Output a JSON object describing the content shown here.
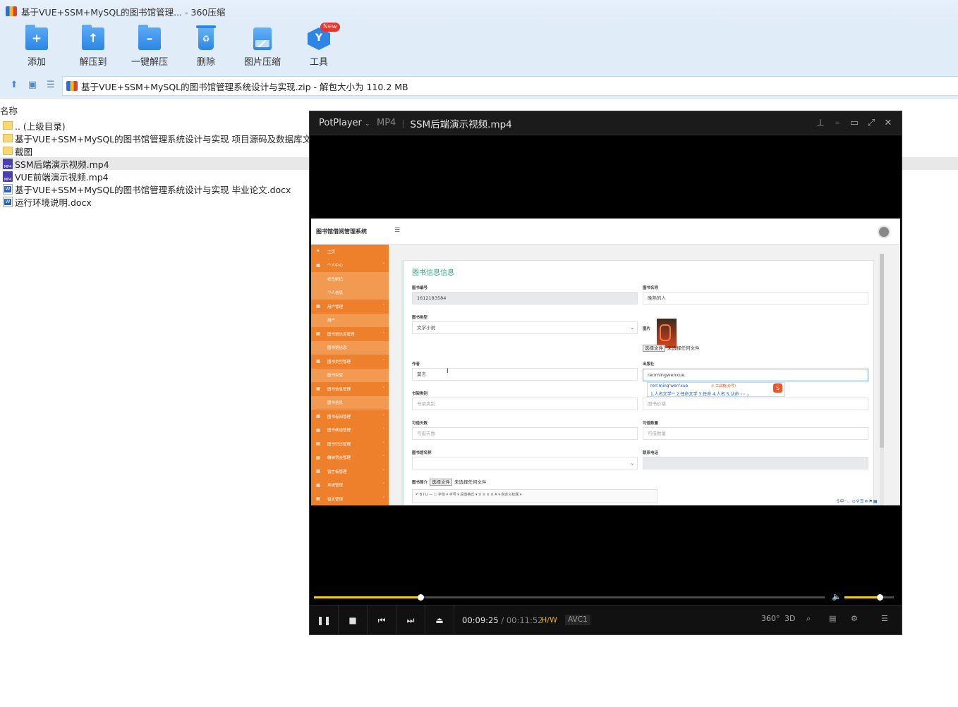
{
  "window": {
    "title": "基于VUE+SSM+MySQL的图书馆管理... - 360压缩"
  },
  "toolbar": {
    "items": [
      {
        "label": "添加",
        "icon": "add-folder-icon"
      },
      {
        "label": "解压到",
        "icon": "extract-to-icon"
      },
      {
        "label": "一键解压",
        "icon": "one-click-extract-icon"
      },
      {
        "label": "删除",
        "icon": "delete-bin-icon"
      },
      {
        "label": "图片压缩",
        "icon": "image-compress-icon"
      },
      {
        "label": "工具",
        "icon": "tools-icon"
      }
    ],
    "new_badge": "New"
  },
  "address": {
    "path": "基于VUE+SSM+MySQL的图书馆管理系统设计与实现.zip - 解包大小为 110.2 MB"
  },
  "filelist": {
    "header": "名称",
    "rows": [
      {
        "name": ".. (上级目录)",
        "type": "folder"
      },
      {
        "name": "基于VUE+SSM+MySQL的图书馆管理系统设计与实现 项目源码及数据库文件",
        "type": "folder"
      },
      {
        "name": "截图",
        "type": "folder"
      },
      {
        "name": "SSM后端演示视频.mp4",
        "type": "mp4"
      },
      {
        "name": "VUE前端演示视频.mp4",
        "type": "mp4"
      },
      {
        "name": "基于VUE+SSM+MySQL的图书馆管理系统设计与实现 毕业论文.docx",
        "type": "docx"
      },
      {
        "name": "运行环境说明.docx",
        "type": "docx"
      }
    ]
  },
  "player": {
    "brand": "PotPlayer",
    "format": "MP4",
    "filename": "SSM后端演示视频.mp4",
    "time_current": "00:09:25",
    "time_total": "/ 00:11:52",
    "hw_label": "H/W",
    "codec": "AVC1",
    "progress_fraction": 0.209,
    "volume_fraction": 0.72,
    "right_controls": {
      "vr": "360°",
      "stereo": "3D"
    }
  },
  "video": {
    "system_title": "图书馆借阅管理系统",
    "sidebar": [
      {
        "label": "主页",
        "kind": "group",
        "arrow": false
      },
      {
        "label": "个人中心",
        "kind": "group",
        "arrow": true
      },
      {
        "label": "修改密码",
        "kind": "sub"
      },
      {
        "label": "个人信息",
        "kind": "sub"
      },
      {
        "label": "用户管理",
        "kind": "group",
        "arrow": true
      },
      {
        "label": "用户",
        "kind": "sub"
      },
      {
        "label": "图书馆信息管理",
        "kind": "group",
        "arrow": true
      },
      {
        "label": "图书馆信息",
        "kind": "sub"
      },
      {
        "label": "图书类型管理",
        "kind": "group",
        "arrow": true
      },
      {
        "label": "图书类型",
        "kind": "sub"
      },
      {
        "label": "图书信息管理",
        "kind": "group",
        "arrow": true
      },
      {
        "label": "图书信息",
        "kind": "sub"
      },
      {
        "label": "图书借阅管理",
        "kind": "group",
        "arrow": true
      },
      {
        "label": "图书续借管理",
        "kind": "group",
        "arrow": true
      },
      {
        "label": "图书归还管理",
        "kind": "group",
        "arrow": true
      },
      {
        "label": "缴纳罚金管理",
        "kind": "group",
        "arrow": true
      },
      {
        "label": "留言板管理",
        "kind": "group",
        "arrow": true
      },
      {
        "label": "系统管理",
        "kind": "group",
        "arrow": true
      },
      {
        "label": "留言管理",
        "kind": "group",
        "arrow": true
      }
    ],
    "form": {
      "title": "图书信息信息",
      "book_no_label": "图书编号",
      "book_no_value": "1612183584",
      "book_name_label": "图书名称",
      "book_name_value": "晚熟的人",
      "book_type_label": "图书类型",
      "book_type_value": "文学小说",
      "image_label": "图片",
      "choose_file": "选择文件",
      "no_file": "未选择任何文件",
      "author_label": "作者",
      "author_value": "莫言",
      "publisher_label": "出版社",
      "publisher_value": "renmingwenxue",
      "shelf_label": "书架类别",
      "shelf_placeholder": "书架类别",
      "price_placeholder": "图书价格",
      "borrow_days_label": "可借天数",
      "borrow_days_placeholder": "可借天数",
      "borrow_count_label": "可借数量",
      "borrow_count_placeholder": "可借数量",
      "library_label": "图书馆名称",
      "phone_label": "联系电话",
      "intro_label": "图书简介",
      "editor_toolbar": "↶ B I U — ▭  字体 ▾  字号 ▾  段落格式 ▾  ≡ ≡ ≡ ≡  A ▾  自定义标题 ▾"
    },
    "ime": {
      "composition": "ren'ming'wen'xue",
      "tip": "① 工具箱(分号)",
      "candidates": "1.人名文学⁽ᶜ⁾  2.任命文学  3.任命  4.人名  5.认命  ‹ › ⌄",
      "logo": "S"
    },
    "tray": "S中·、⊙⚲☰✉⚑▦"
  }
}
